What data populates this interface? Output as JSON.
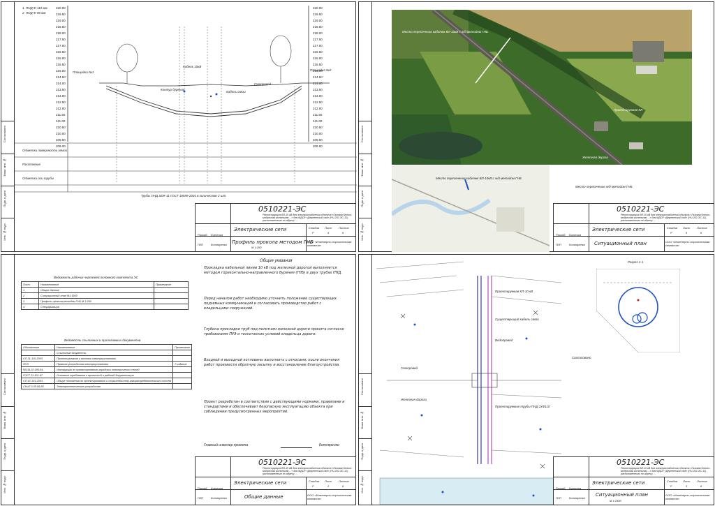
{
  "document": {
    "code": "0510221-ЭС",
    "project_desc": "Реконструкция ВЛ-10 кВ для электроснабжения объекта «Газовая блочно-модульная котельная ...» для МДОУ «Деревенский сад» (НЧ-202-ЭС-11), расположенного по адресу: ...",
    "section": "Электрические сети",
    "org": "ООО «Инженерно-строительная компания»",
    "roles": {
      "developer": "Разраб.",
      "checker": "Провер.",
      "gip": "ГИП"
    },
    "names": {
      "developer": "Кузнецов",
      "gip": "Котляренко"
    },
    "stamp_headers": {
      "stage": "Стадия",
      "sheet": "Лист",
      "sheets": "Листов",
      "change": "Изм.",
      "count": "Кол.уч",
      "list": "Лист",
      "doc": "№док.",
      "sign": "Подп.",
      "date": "Дата"
    },
    "sidebar_labels": [
      "Инв. № подл.",
      "Подп. и дата",
      "Взам. инв. №",
      "Согласовано"
    ]
  },
  "sheets": [
    {
      "title": "Профиль прокола методом ГНБ",
      "scale": "М 1:250",
      "stage": "Р",
      "sheet": "4",
      "sheets": "6",
      "elevations": [
        "220.00",
        "219.50",
        "219.00",
        "218.50",
        "218.00",
        "217.50",
        "217.00",
        "216.50",
        "216.00",
        "215.50",
        "215.00",
        "214.50",
        "214.00",
        "213.50",
        "213.00",
        "212.50",
        "212.00",
        "211.50",
        "211.00",
        "210.50",
        "210.00",
        "209.50",
        "209.00"
      ],
      "legend": [
        "1. ПНД Ф-110 мм.",
        "2. ПНД Ф-90 мм"
      ],
      "annotations": [
        "Площадка №1",
        "Площадка №2",
        "Контур бурения",
        "Кабель связи",
        "Газопровод",
        "Кабель 10кВ"
      ],
      "row_labels": [
        "Отметки поверхности земли",
        "Расстояние",
        "Отметки оси трубы"
      ],
      "footnote": "Трубы ПНД SDR 11 ГОСТ 18599-2001 в количестве 2 шт."
    },
    {
      "title": "Ситуационный план",
      "scale": "",
      "stage": "Р",
      "sheet": "5",
      "sheets": "6",
      "map_labels": [
        "Место пересечения кабелем ВЛ-10кВ с ж/д методом ГНБ",
        "Проектируемая КЛ",
        "Железная дорога"
      ],
      "caption": "Место пересечения ж/д методом ГНБ"
    },
    {
      "title": "Общие данные",
      "scale": "",
      "stage": "Р",
      "sheet": "2",
      "sheets": "6",
      "heading": "Общие указания",
      "table1_title": "Ведомость рабочих чертежей основного комплекта ЭС",
      "table1_headers": [
        "Лист",
        "Наименование",
        "Примечание"
      ],
      "table1_rows": [
        [
          "1",
          "Общие данные",
          ""
        ],
        [
          "2",
          "Ситуационный план М1:1500",
          ""
        ],
        [
          "3",
          "Профиль прокола методом ГНБ М 1:250",
          ""
        ],
        [
          "4",
          "Спецификация",
          ""
        ]
      ],
      "table2_title": "Ведомость ссылочных и прилагаемых документов",
      "table2_headers": [
        "Обозначение",
        "Наименование",
        "Примечание"
      ],
      "table2_rows": [
        [
          "",
          "Ссылочные документы",
          ""
        ],
        [
          "СП 31-110-2003",
          "Проектирование и монтаж электроустановок",
          ""
        ],
        [
          "ПУЭ",
          "Правила устройства электроустановок",
          "7 издание"
        ],
        [
          "РД 34.20.185-94",
          "Инструкция по проектированию городских электрических сетей",
          ""
        ],
        [
          "ГОСТ 21.101-97",
          "Основные требования к проектной и рабочей документации",
          ""
        ],
        [
          "СП 42-101-2003",
          "Общие положения по проектированию и строительству газораспределительных систем",
          ""
        ],
        [
          "СНиП 3.05.06-85",
          "Электротехнические устройства",
          ""
        ]
      ],
      "paragraphs": [
        "Прокладка кабельной линии 10 кВ под железной дорогой выполняется методом горизонтально-направленного бурения (ГНБ) в двух трубах ПНД.",
        "Перед началом работ необходимо уточнить положение существующих подземных коммуникаций и согласовать производство работ с владельцами сооружений.",
        "Глубина прокладки труб под полотном железной дороги принята согласно требованиям ПУЭ и технических условий владельца дороги.",
        "Входной и выходной котлованы выполнить с откосами, после окончания работ произвести обратную засыпку и восстановление благоустройства.",
        "Проект разработан в соответствии с действующими нормами, правилами и стандартами и обеспечивает безопасную эксплуатацию объекта при соблюдении предусмотренных мероприятий."
      ],
      "signature_line": "Главный инженер проекта",
      "signature_name": "Котляренко"
    },
    {
      "title": "Ситуационный план",
      "scale": "М 1:1500",
      "stage": "Р",
      "sheet": "3",
      "sheets": "6",
      "notes": [
        "Проектируемая КЛ-10 кВ",
        "Существующий кабель связи",
        "Водопровод",
        "Газопровод",
        "Железная дорога",
        "Проектируемые трубы ПНД 2хФ110"
      ],
      "section_label": "Разрез 1-1",
      "side_label": "Согласовано"
    }
  ]
}
